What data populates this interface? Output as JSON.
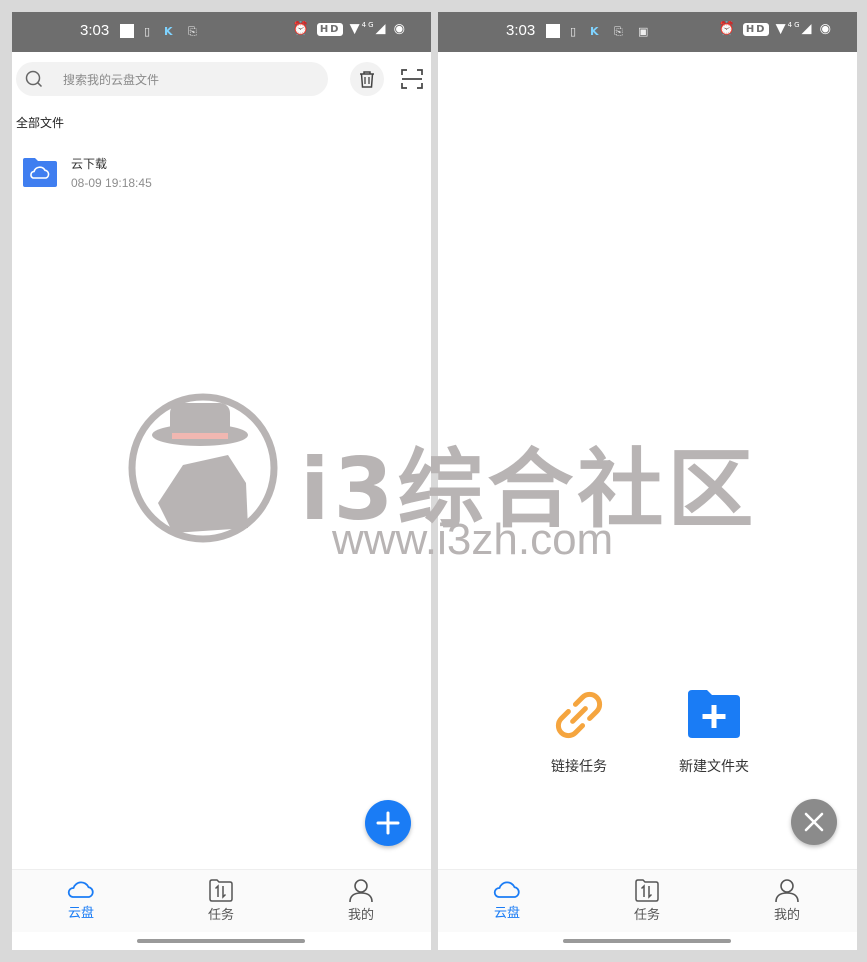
{
  "status_bar": {
    "time": "3:03",
    "hd_badge": "HD",
    "network": "4G"
  },
  "left_screen": {
    "search_placeholder": "搜索我的云盘文件",
    "breadcrumb": "全部文件",
    "files": [
      {
        "name": "云下载",
        "modified": "08-09 19:18:45",
        "icon": "cloud-folder-icon"
      }
    ],
    "fab_icon": "plus-icon"
  },
  "right_screen": {
    "actions": [
      {
        "label": "链接任务",
        "icon": "link-icon"
      },
      {
        "label": "新建文件夹",
        "icon": "new-folder-icon"
      }
    ],
    "close_icon": "close-icon"
  },
  "tabs": [
    {
      "label": "云盘",
      "icon": "cloud-icon",
      "active": true
    },
    {
      "label": "任务",
      "icon": "transfer-icon",
      "active": false
    },
    {
      "label": "我的",
      "icon": "person-icon",
      "active": false
    }
  ],
  "watermark": {
    "title": "i3综合社区",
    "url": "www.i3zh.com"
  },
  "colors": {
    "accent": "#1a7cf5",
    "link_orange": "#f5a53f",
    "status_bar": "#6e6e6e",
    "close_gray": "#8b8b8b"
  }
}
